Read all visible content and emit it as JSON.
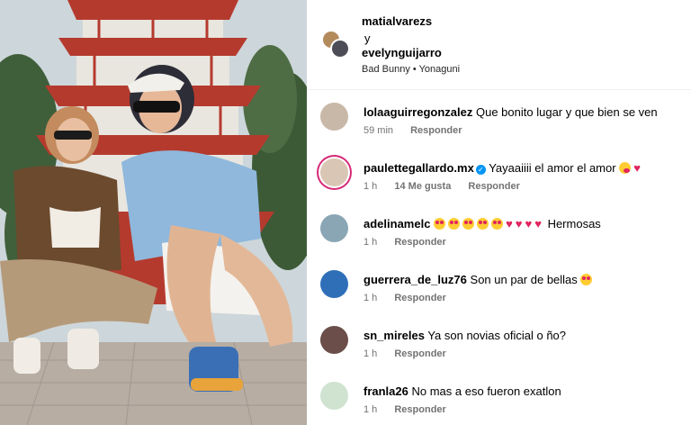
{
  "header": {
    "user1": "matialvarezs",
    "conjunction": "y",
    "user2": "evelynguijarro",
    "audio_artist": "Bad Bunny",
    "audio_separator": "•",
    "audio_track": "Yonaguni"
  },
  "comments": [
    {
      "username": "lolaaguirregonzalez",
      "text": "Que bonito lugar y que bien se ven",
      "time": "59 min",
      "likes": "",
      "reply": "Responder",
      "verified": false,
      "emojis": [],
      "avatar_color": "#c8b8a8"
    },
    {
      "username": "paulettegallardo.mx",
      "text": "Yayaaiiii el amor el amor",
      "time": "1 h",
      "likes": "14 Me gusta",
      "reply": "Responder",
      "verified": true,
      "emojis": [
        "hug",
        "heart"
      ],
      "avatar_color": "#d9c6b4"
    },
    {
      "username": "adelinamelc",
      "text": "Hermosas",
      "time": "1 h",
      "likes": "",
      "reply": "Responder",
      "verified": false,
      "emojis": [
        "eyes",
        "eyes",
        "eyes",
        "eyes",
        "eyes",
        "heart",
        "heart",
        "heart",
        "heart"
      ],
      "avatar_color": "#8aa6b5"
    },
    {
      "username": "guerrera_de_luz76",
      "text": "Son un par de bellas",
      "time": "1 h",
      "likes": "",
      "reply": "Responder",
      "verified": false,
      "emojis": [
        "eyes"
      ],
      "avatar_color": "#2f6fb8"
    },
    {
      "username": "sn_mireles",
      "text": "Ya son novias oficial o ño?",
      "time": "1 h",
      "likes": "",
      "reply": "Responder",
      "verified": false,
      "emojis": [],
      "avatar_color": "#6b4e4a"
    },
    {
      "username": "franla26",
      "text": "No mas a eso fueron exatlon",
      "time": "1 h",
      "likes": "",
      "reply": "Responder",
      "verified": false,
      "emojis": [],
      "avatar_color": "#cfe3d0"
    }
  ],
  "icons": {
    "verified": "verified-check-icon",
    "eyes": "heart-eyes-emoji",
    "heart": "red-heart-emoji",
    "hug": "smiling-hearts-emoji"
  },
  "colors": {
    "meta_text": "#737373",
    "verified_blue": "#0095f6",
    "story_ring": "#d62976",
    "heart_red": "#e0245e"
  }
}
